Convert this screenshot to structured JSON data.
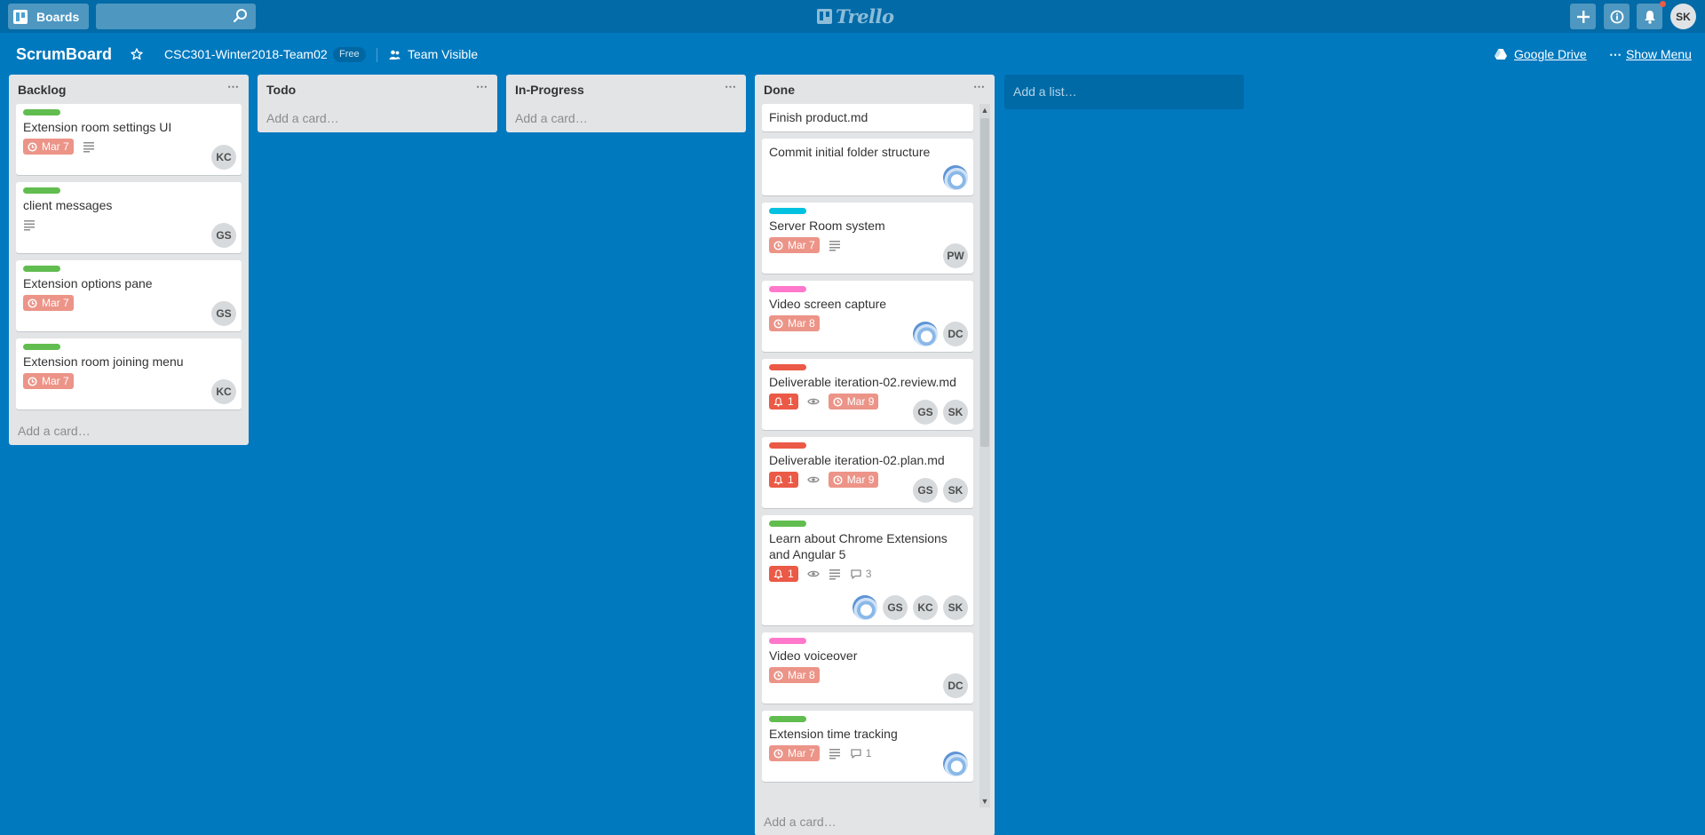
{
  "header": {
    "boards_label": "Boards",
    "search_placeholder": "",
    "logo_text": "Trello",
    "user_initials": "SK"
  },
  "board": {
    "title": "ScrumBoard",
    "team": "CSC301-Winter2018-Team02",
    "team_badge": "Free",
    "visibility": "Team Visible",
    "google_drive": "Google Drive",
    "show_menu": "Show Menu",
    "menu_dots": "⋯"
  },
  "lists": {
    "backlog": {
      "title": "Backlog",
      "menu": "⋯",
      "add_card": "Add a card…",
      "cards": [
        {
          "title": "Extension room settings UI",
          "label_color": "#61bd4f",
          "due": "Mar 7",
          "description": true,
          "members": [
            "KC"
          ]
        },
        {
          "title": "client messages",
          "label_color": "#61bd4f",
          "description": true,
          "members": [
            "GS"
          ]
        },
        {
          "title": "Extension options pane",
          "label_color": "#61bd4f",
          "due": "Mar 7",
          "members": [
            "GS"
          ]
        },
        {
          "title": "Extension room joining menu",
          "label_color": "#61bd4f",
          "due": "Mar 7",
          "members": [
            "KC"
          ]
        }
      ]
    },
    "todo": {
      "title": "Todo",
      "menu": "⋯",
      "add_card": "Add a card…"
    },
    "in_progress": {
      "title": "In-Progress",
      "menu": "⋯",
      "add_card": "Add a card…"
    },
    "done": {
      "title": "Done",
      "menu": "⋯",
      "add_card": "Add a card…",
      "cards": [
        {
          "title": "Finish product.md"
        },
        {
          "title": "Commit initial folder structure",
          "members": [
            "photo"
          ]
        },
        {
          "title": "Server Room system",
          "label_color": "#00c2e0",
          "due": "Mar 7",
          "description": true,
          "members": [
            "PW"
          ]
        },
        {
          "title": "Video screen capture",
          "label_color": "#ff78cb",
          "due": "Mar 8",
          "members": [
            "photo",
            "DC"
          ]
        },
        {
          "title": "Deliverable iteration-02.review.md",
          "label_color": "#eb5a46",
          "alert": "1",
          "watch": true,
          "due": "Mar 9",
          "members": [
            "GS",
            "SK"
          ]
        },
        {
          "title": "Deliverable iteration-02.plan.md",
          "label_color": "#eb5a46",
          "alert": "1",
          "watch": true,
          "due": "Mar 9",
          "members": [
            "GS",
            "SK"
          ]
        },
        {
          "title": "Learn about Chrome Extensions and Angular 5",
          "label_color": "#61bd4f",
          "alert": "1",
          "watch": true,
          "description": true,
          "comments": "3",
          "members": [
            "photo",
            "GS",
            "KC",
            "SK"
          ]
        },
        {
          "title": "Video voiceover",
          "label_color": "#ff78cb",
          "due": "Mar 8",
          "members": [
            "DC"
          ]
        },
        {
          "title": "Extension time tracking",
          "label_color": "#61bd4f",
          "due": "Mar 7",
          "description": true,
          "comments": "1",
          "members": [
            "photo"
          ]
        }
      ]
    }
  },
  "add_list": "Add a list…",
  "colors": {
    "board_bg": "#0079bf",
    "header_bg": "#026aa7",
    "list_bg": "#e2e4e6",
    "due_bg": "#ec9488",
    "alert_bg": "#eb5a46",
    "label_green": "#61bd4f",
    "label_blue": "#00c2e0",
    "label_pink": "#ff78cb",
    "label_red": "#eb5a46"
  },
  "icons": [
    "boards-icon",
    "search-icon",
    "trello-logo-icon",
    "plus-icon",
    "info-icon",
    "bell-icon",
    "star-icon",
    "visibility-icon",
    "google-drive-icon",
    "clock-icon",
    "description-icon",
    "eye-icon",
    "comment-icon",
    "alert-bell-icon",
    "scroll-up-icon",
    "scroll-down-icon"
  ]
}
